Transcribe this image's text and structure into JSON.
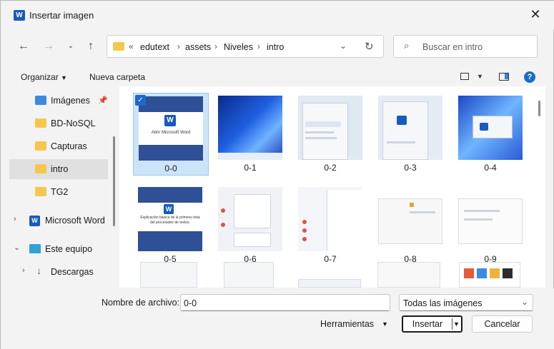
{
  "window": {
    "title": "Insertar imagen",
    "app_icon": "word-icon"
  },
  "nav": {
    "path_prefix": "«",
    "breadcrumb": [
      "edutext",
      "assets",
      "Niveles",
      "intro"
    ],
    "search_placeholder": "Buscar en intro"
  },
  "toolbar": {
    "organize": "Organizar",
    "new_folder": "Nueva carpeta"
  },
  "sidebar": {
    "items": [
      {
        "label": "Imágenes",
        "icon": "pictures-icon"
      },
      {
        "label": "BD-NoSQL",
        "icon": "folder-icon"
      },
      {
        "label": "Capturas",
        "icon": "folder-icon"
      },
      {
        "label": "intro",
        "icon": "folder-icon",
        "selected": true
      },
      {
        "label": "TG2",
        "icon": "folder-icon"
      },
      {
        "label": "Microsoft Word",
        "icon": "word-icon"
      },
      {
        "label": "Este equipo",
        "icon": "computer-icon"
      },
      {
        "label": "Descargas",
        "icon": "download-icon"
      }
    ]
  },
  "files": [
    {
      "name": "0-0",
      "selected": true
    },
    {
      "name": "0-1"
    },
    {
      "name": "0-2"
    },
    {
      "name": "0-3"
    },
    {
      "name": "0-4"
    },
    {
      "name": "0-5"
    },
    {
      "name": "0-6"
    },
    {
      "name": "0-7"
    },
    {
      "name": "0-8"
    },
    {
      "name": "0-9"
    }
  ],
  "thumb_text": {
    "word_open": "Abrir Microsoft Word",
    "word_expl": "Explicación básica de la primera vista del procesador de textos."
  },
  "footer": {
    "filename_label": "Nombre de archivo:",
    "filename_value": "0-0",
    "filter_value": "Todas las imágenes",
    "tools": "Herramientas",
    "insert": "Insertar",
    "cancel": "Cancelar"
  },
  "colors": {
    "accent": "#1b6ac9",
    "word_blue": "#2f4f97",
    "selection": "#cce4f7",
    "folder": "#f5c74c"
  }
}
